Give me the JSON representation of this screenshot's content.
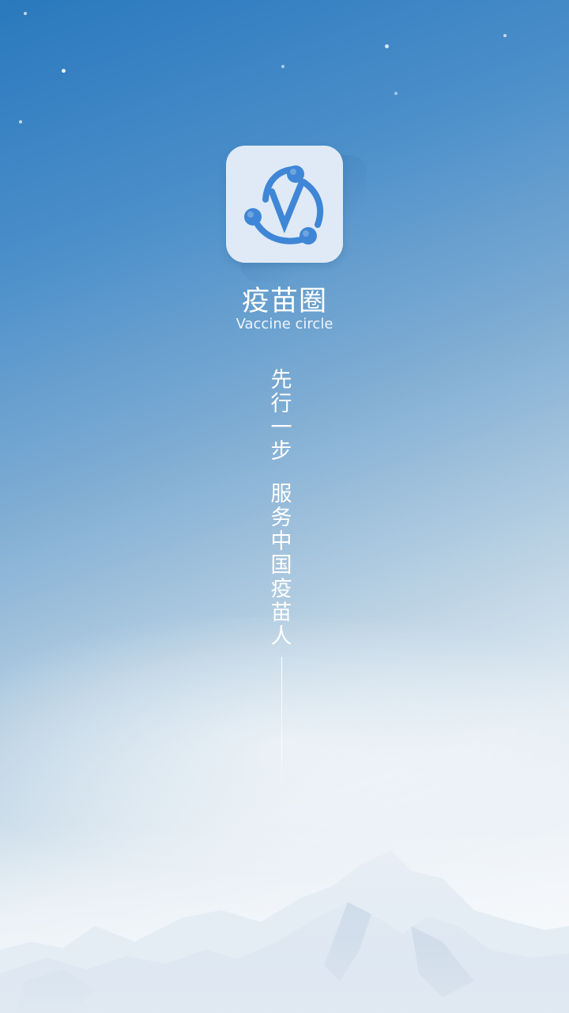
{
  "app": {
    "name": "疫苗圈",
    "subtitle": "Vaccine circle",
    "icon": "vaccine-circle-logo-icon"
  },
  "slogan": {
    "part1": [
      "先",
      "行",
      "一",
      "步"
    ],
    "part2": [
      "服",
      "务",
      "中",
      "国",
      "疫",
      "苗",
      "人"
    ]
  },
  "colors": {
    "sky_top": "#2a78bd",
    "sky_bottom": "#f5f7fa",
    "logo_blue": "#3f86d6",
    "icon_bg": "#dfeaf6"
  }
}
